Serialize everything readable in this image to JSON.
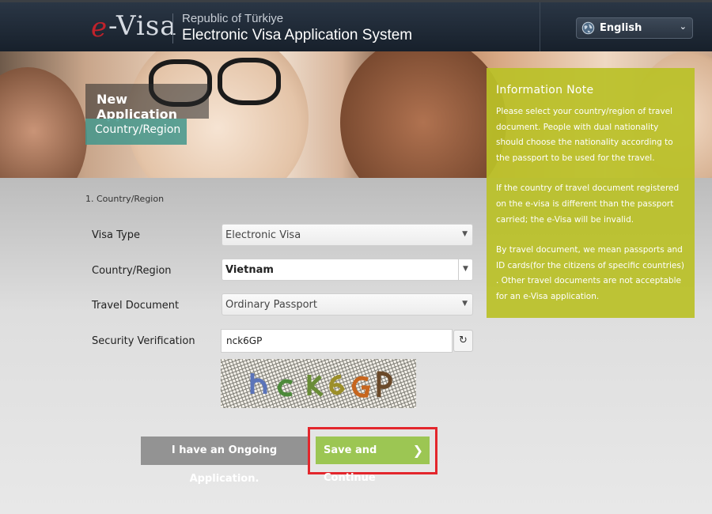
{
  "header": {
    "logo_e": "e",
    "logo_visa": "-Visa",
    "subtitle": "Republic of Türkiye",
    "title": "Electronic Visa Application System",
    "language": {
      "icon": "globe-icon",
      "value": "English"
    }
  },
  "hero": {
    "heading": "New Application",
    "tab": "Country/Region"
  },
  "form": {
    "step": "1. Country/Region",
    "visa_type": {
      "label": "Visa Type",
      "value": "Electronic Visa"
    },
    "country": {
      "label": "Country/Region",
      "value": "Vietnam"
    },
    "travel_document": {
      "label": "Travel Document",
      "value": "Ordinary Passport"
    },
    "security": {
      "label": "Security Verification",
      "value": "nck6GP"
    }
  },
  "buttons": {
    "ongoing": "I have an Ongoing Application.",
    "save": "Save and Continue"
  },
  "info_note": {
    "title": "Information Note",
    "paragraphs": [
      "Please select your country/region of travel document. People with dual nationality should choose the nationality according to the passport to be used for the travel.",
      "If the country of travel document registered on the e-visa is different than the passport carried; the e-Visa will be invalid.",
      "By travel document, we mean passports and ID cards(for the citizens of specific countries) . Other travel documents are not acceptable for an e-Visa application."
    ]
  },
  "colors": {
    "header_bg": "#1c2632",
    "accent_green": "#9cc653",
    "info_bg": "#bac128",
    "highlight_red": "#e3262c",
    "logo_red": "#c0222b"
  }
}
